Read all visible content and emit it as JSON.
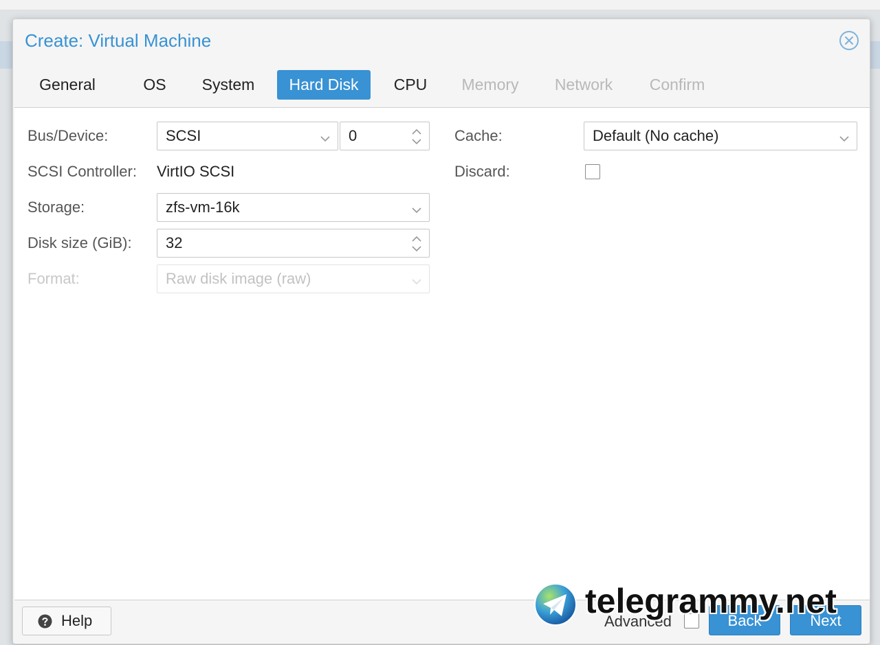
{
  "dialog": {
    "title": "Create: Virtual Machine"
  },
  "tabs": [
    {
      "label": "General",
      "state": "normal"
    },
    {
      "label": "OS",
      "state": "normal"
    },
    {
      "label": "System",
      "state": "normal"
    },
    {
      "label": "Hard Disk",
      "state": "active"
    },
    {
      "label": "CPU",
      "state": "normal"
    },
    {
      "label": "Memory",
      "state": "disabled"
    },
    {
      "label": "Network",
      "state": "disabled"
    },
    {
      "label": "Confirm",
      "state": "disabled"
    }
  ],
  "form": {
    "bus_device": {
      "label": "Bus/Device:",
      "bus_value": "SCSI",
      "device_value": "0"
    },
    "scsi_controller": {
      "label": "SCSI Controller:",
      "value": "VirtIO SCSI"
    },
    "storage": {
      "label": "Storage:",
      "value": "zfs-vm-16k"
    },
    "disk_size": {
      "label": "Disk size (GiB):",
      "value": "32"
    },
    "format": {
      "label": "Format:",
      "value": "Raw disk image (raw)",
      "disabled": true
    },
    "cache": {
      "label": "Cache:",
      "value": "Default (No cache)"
    },
    "discard": {
      "label": "Discard:",
      "checked": false
    }
  },
  "footer": {
    "help_label": "Help",
    "advanced_label": "Advanced",
    "advanced_checked": false,
    "back_label": "Back",
    "next_label": "Next"
  },
  "watermark": {
    "text": "telegrammy.net"
  },
  "colors": {
    "accent": "#3892d4",
    "disabled_text": "#b8b8b8"
  },
  "icons": {
    "close": "close-circle-icon",
    "dropdown": "chevron-down-icon",
    "spinner": "spinner-arrows-icon",
    "help": "question-circle-icon",
    "watermark_logo": "telegram-logo-icon"
  }
}
